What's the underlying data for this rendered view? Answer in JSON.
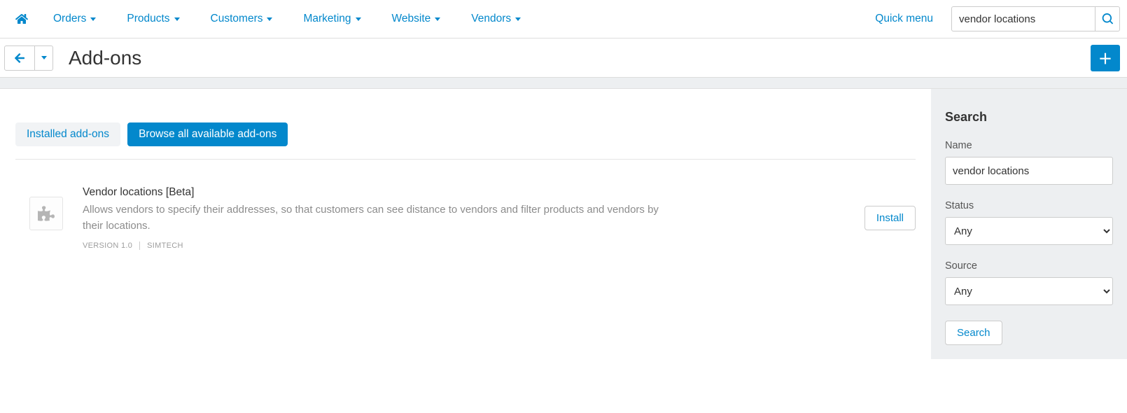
{
  "nav": {
    "items": [
      "Orders",
      "Products",
      "Customers",
      "Marketing",
      "Website",
      "Vendors"
    ],
    "quick_menu": "Quick menu",
    "search_value": "vendor locations"
  },
  "page": {
    "title": "Add-ons"
  },
  "tabs": {
    "installed": "Installed add-ons",
    "browse": "Browse all available add-ons"
  },
  "addons": [
    {
      "title": "Vendor locations [Beta]",
      "description": "Allows vendors to specify their addresses, so that customers can see distance to vendors and filter products and vendors by their locations.",
      "version": "VERSION 1.0",
      "vendor": "SIMTECH",
      "install_label": "Install"
    }
  ],
  "sidebar": {
    "title": "Search",
    "name_label": "Name",
    "name_value": "vendor locations",
    "status_label": "Status",
    "status_value": "Any",
    "source_label": "Source",
    "source_value": "Any",
    "search_button": "Search"
  }
}
